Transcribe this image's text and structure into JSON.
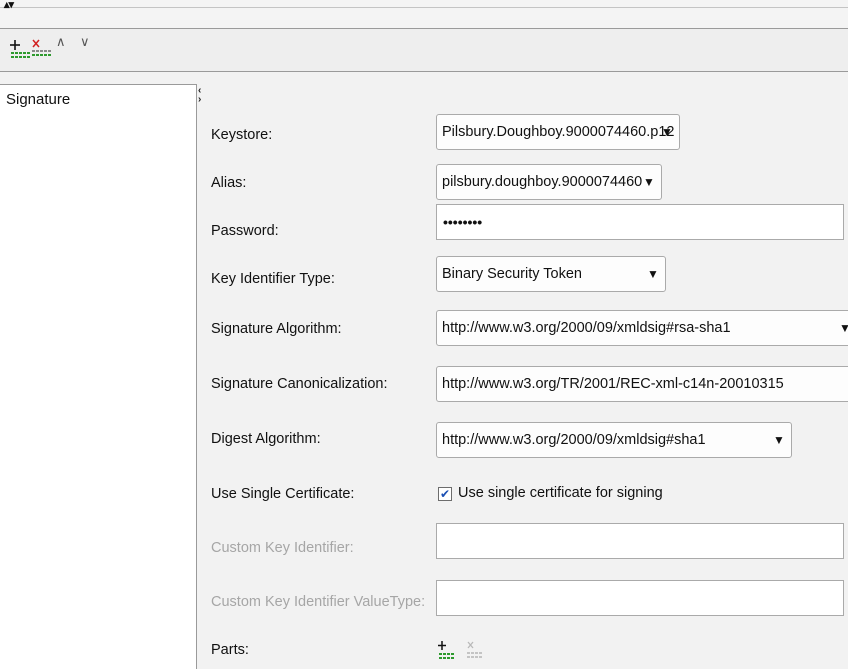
{
  "toolbar": {
    "collapse_expand_label": "▴▾",
    "move_up_label": "∧",
    "move_down_label": "∨"
  },
  "list": {
    "items": [
      "Signature"
    ]
  },
  "splitter": {
    "arrows": "‹›"
  },
  "form": {
    "keystore": {
      "label": "Keystore:",
      "value": "Pilsbury.Doughboy.9000074460.p12"
    },
    "alias": {
      "label": "Alias:",
      "value": "pilsbury.doughboy.9000074460"
    },
    "password": {
      "label": "Password:",
      "value": "••••••••"
    },
    "key_identifier_type": {
      "label": "Key Identifier Type:",
      "value": "Binary Security Token"
    },
    "signature_algorithm": {
      "label": "Signature Algorithm:",
      "value": "http://www.w3.org/2000/09/xmldsig#rsa-sha1"
    },
    "signature_canonicalization": {
      "label": "Signature Canonicalization:",
      "value": "http://www.w3.org/TR/2001/REC-xml-c14n-20010315"
    },
    "digest_algorithm": {
      "label": "Digest Algorithm:",
      "value": "http://www.w3.org/2000/09/xmldsig#sha1"
    },
    "use_single_certificate": {
      "label": "Use Single Certificate:",
      "checkbox_label": "Use single certificate for signing",
      "checked": true,
      "check_glyph": "✔"
    },
    "custom_key_identifier": {
      "label": "Custom Key Identifier:",
      "value": ""
    },
    "custom_key_identifier_value_type": {
      "label": "Custom Key Identifier ValueType:",
      "value": ""
    },
    "parts": {
      "label": "Parts:"
    }
  },
  "icons": {
    "add": "add-row-icon",
    "remove": "remove-row-icon",
    "dropdown": "chevron-down-icon"
  },
  "colors": {
    "add_green": "#2e9a2e",
    "remove_red": "#d22020",
    "disabled_text": "#a6a6a6",
    "check_blue": "#1a4fb3"
  },
  "caret_glyph": "▼"
}
